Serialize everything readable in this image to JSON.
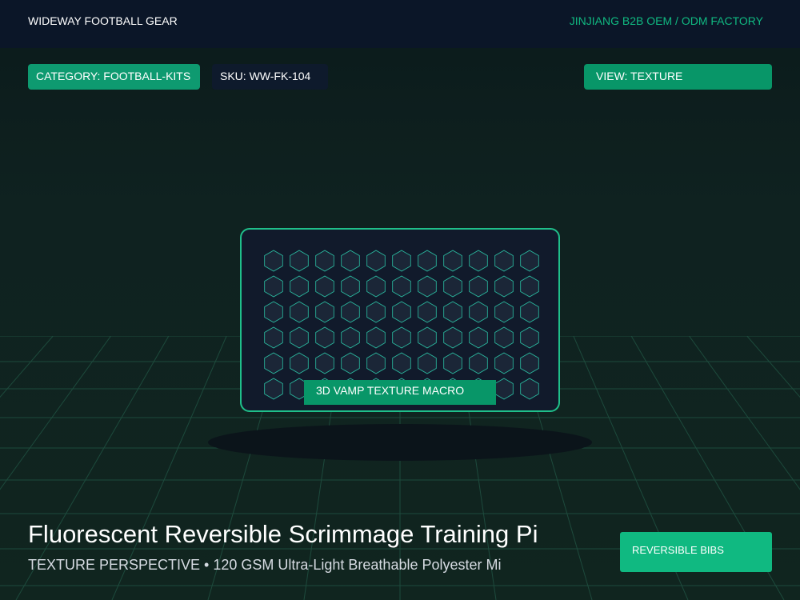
{
  "header": {
    "brand": "WIDEWAY FOOTBALL GEAR",
    "factory": "JINJIANG B2B OEM / ODM FACTORY"
  },
  "chips": {
    "category": "CATEGORY: FOOTBALL-KITS",
    "sku": "SKU: WW-FK-104",
    "view": "VIEW: TEXTURE"
  },
  "macro": {
    "label": "3D VAMP TEXTURE MACRO",
    "pattern": "hexagon-icon"
  },
  "product": {
    "title": "Fluorescent Reversible Scrimmage Training Pi",
    "subtitle": "TEXTURE PERSPECTIVE • 120 GSM Ultra-Light Breathable Polyester Mi",
    "tag": "REVERSIBLE BIBS"
  },
  "colors": {
    "accent": "#10b981",
    "topbar": "#0b1628",
    "panel": "#111a2b"
  }
}
